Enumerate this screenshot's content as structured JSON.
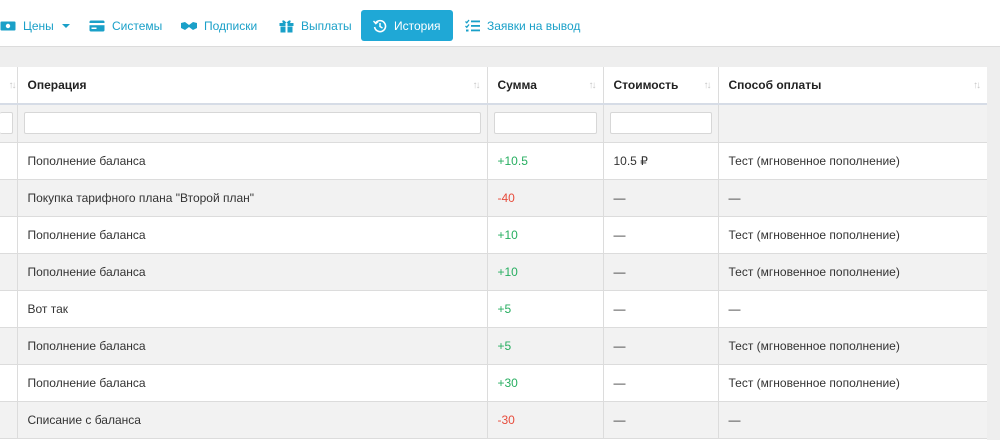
{
  "nav": {
    "prices": {
      "label": "Цены",
      "icon": "money-icon"
    },
    "systems": {
      "label": "Системы",
      "icon": "credit-card-icon"
    },
    "subscriptions": {
      "label": "Подписки",
      "icon": "handshake-icon"
    },
    "payouts": {
      "label": "Выплаты",
      "icon": "gift-icon"
    },
    "history": {
      "label": "История",
      "icon": "history-icon"
    },
    "withdraw": {
      "label": "Заявки на вывод",
      "icon": "tasks-list-icon"
    }
  },
  "colors": {
    "accent": "#1fa8d6",
    "link": "#1aa0c8",
    "positive": "#27ae60",
    "negative": "#e74c3c"
  },
  "table": {
    "columns": [
      "Операция",
      "Сумма",
      "Стоимость",
      "Способ оплаты"
    ],
    "rows": [
      {
        "operation": "Пополнение баланса",
        "amount": "+10.5",
        "sign": "pos",
        "cost": "10.5 ₽",
        "method": "Тест (мгновенное пополнение)"
      },
      {
        "operation": "Покупка тарифного плана \"Второй план\"",
        "amount": "-40",
        "sign": "neg",
        "cost": "—",
        "method": "—"
      },
      {
        "operation": "Пополнение баланса",
        "amount": "+10",
        "sign": "pos",
        "cost": "—",
        "method": "Тест (мгновенное пополнение)"
      },
      {
        "operation": "Пополнение баланса",
        "amount": "+10",
        "sign": "pos",
        "cost": "—",
        "method": "Тест (мгновенное пополнение)"
      },
      {
        "operation": "Вот так",
        "amount": "+5",
        "sign": "pos",
        "cost": "—",
        "method": "—"
      },
      {
        "operation": "Пополнение баланса",
        "amount": "+5",
        "sign": "pos",
        "cost": "—",
        "method": "Тест (мгновенное пополнение)"
      },
      {
        "operation": "Пополнение баланса",
        "amount": "+30",
        "sign": "pos",
        "cost": "—",
        "method": "Тест (мгновенное пополнение)"
      },
      {
        "operation": "Списание с баланса",
        "amount": "-30",
        "sign": "neg",
        "cost": "—",
        "method": "—"
      }
    ]
  }
}
